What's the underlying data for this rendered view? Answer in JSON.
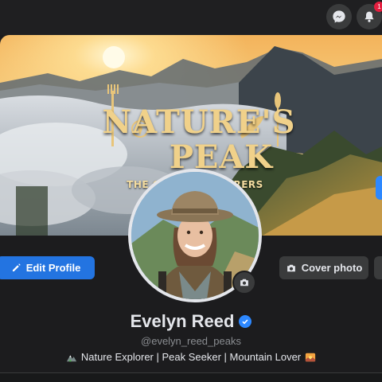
{
  "topbar": {
    "icons": [
      "messenger-icon",
      "bell-icon"
    ],
    "notification_count": "1"
  },
  "cover": {
    "title_line1": "NATURE'S",
    "title_line2": "PEAK",
    "subtitle": "THE GRAND EXPLORERS"
  },
  "actions": {
    "edit_profile": "Edit Profile",
    "cover_photo": "Cover photo"
  },
  "profile": {
    "name": "Evelyn Reed",
    "handle": "@evelyn_reed_peaks",
    "bio": "Nature Explorer | Peak Seeker | Mountain Lover"
  },
  "colors": {
    "accent": "#2374e1",
    "verified": "#2d88ff",
    "badge": "#e41e3f",
    "background": "#1c1c1e",
    "gold": "#f0d18a"
  }
}
